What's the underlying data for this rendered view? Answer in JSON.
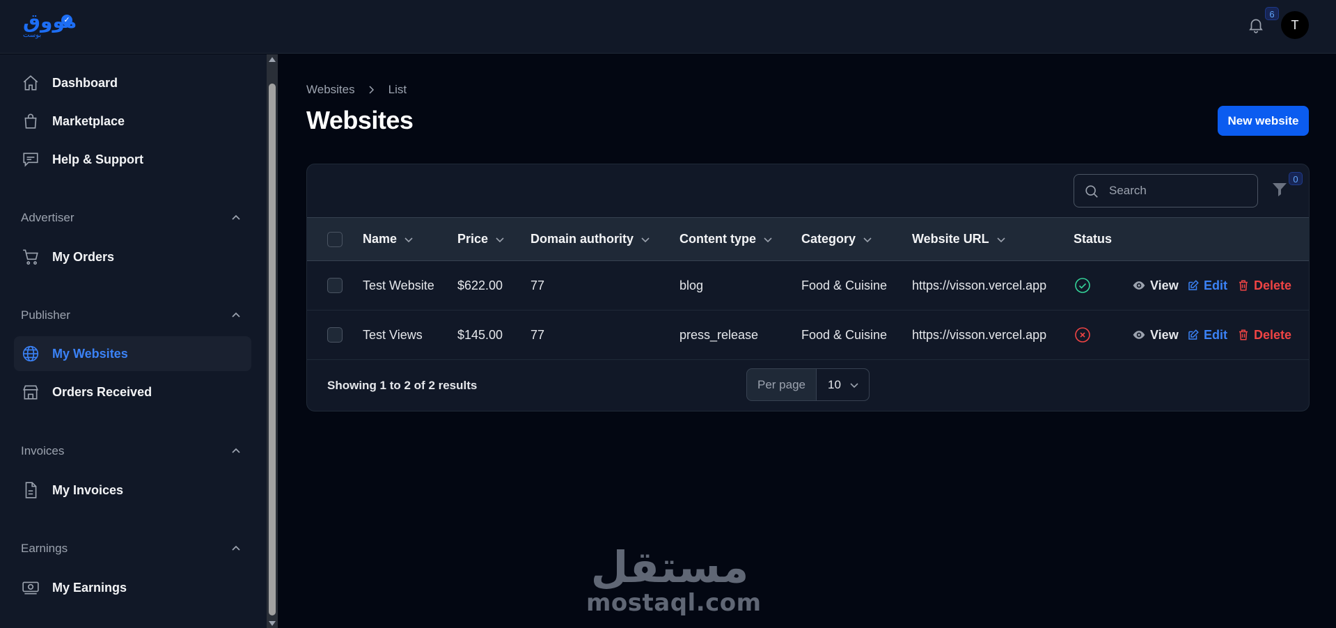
{
  "header": {
    "logo_text": "مووق",
    "logo_sub": "بوست",
    "notifications_count": "6",
    "avatar_initial": "T"
  },
  "sidebar": {
    "top_items": [
      {
        "label": "Dashboard",
        "icon": "home-icon"
      },
      {
        "label": "Marketplace",
        "icon": "shopping-bag-icon"
      },
      {
        "label": "Help & Support",
        "icon": "chat-icon"
      }
    ],
    "groups": [
      {
        "label": "Advertiser",
        "items": [
          {
            "label": "My Orders",
            "icon": "cart-icon"
          }
        ]
      },
      {
        "label": "Publisher",
        "items": [
          {
            "label": "My Websites",
            "icon": "globe-icon",
            "active": true
          },
          {
            "label": "Orders Received",
            "icon": "store-icon"
          }
        ]
      },
      {
        "label": "Invoices",
        "items": [
          {
            "label": "My Invoices",
            "icon": "document-icon"
          }
        ]
      },
      {
        "label": "Earnings",
        "items": [
          {
            "label": "My Earnings",
            "icon": "cash-icon"
          }
        ]
      }
    ]
  },
  "breadcrumb": [
    "Websites",
    "List"
  ],
  "page_title": "Websites",
  "new_button_label": "New website",
  "search": {
    "placeholder": "Search"
  },
  "filter_count": "0",
  "table": {
    "columns": [
      "Name",
      "Price",
      "Domain authority",
      "Content type",
      "Category",
      "Website URL",
      "Status"
    ],
    "rows": [
      {
        "name": "Test Website",
        "price": "$622.00",
        "domain_authority": "77",
        "content_type": "blog",
        "category": "Food & Cuisine",
        "url": "https://visson.vercel.app",
        "status": "approved"
      },
      {
        "name": "Test Views",
        "price": "$145.00",
        "domain_authority": "77",
        "content_type": "press_release",
        "category": "Food & Cuisine",
        "url": "https://visson.vercel.app",
        "status": "rejected"
      }
    ],
    "actions": {
      "view": "View",
      "edit": "Edit",
      "delete": "Delete"
    }
  },
  "pagination": {
    "summary": "Showing 1 to 2 of 2 results",
    "per_page_label": "Per page",
    "per_page_value": "10"
  },
  "watermark": {
    "arabic": "مستقل",
    "latin": "mostaql.com"
  },
  "colors": {
    "accent": "#0b5cf0",
    "success": "#34d399",
    "danger": "#ef4444",
    "link": "#3b82f6"
  }
}
